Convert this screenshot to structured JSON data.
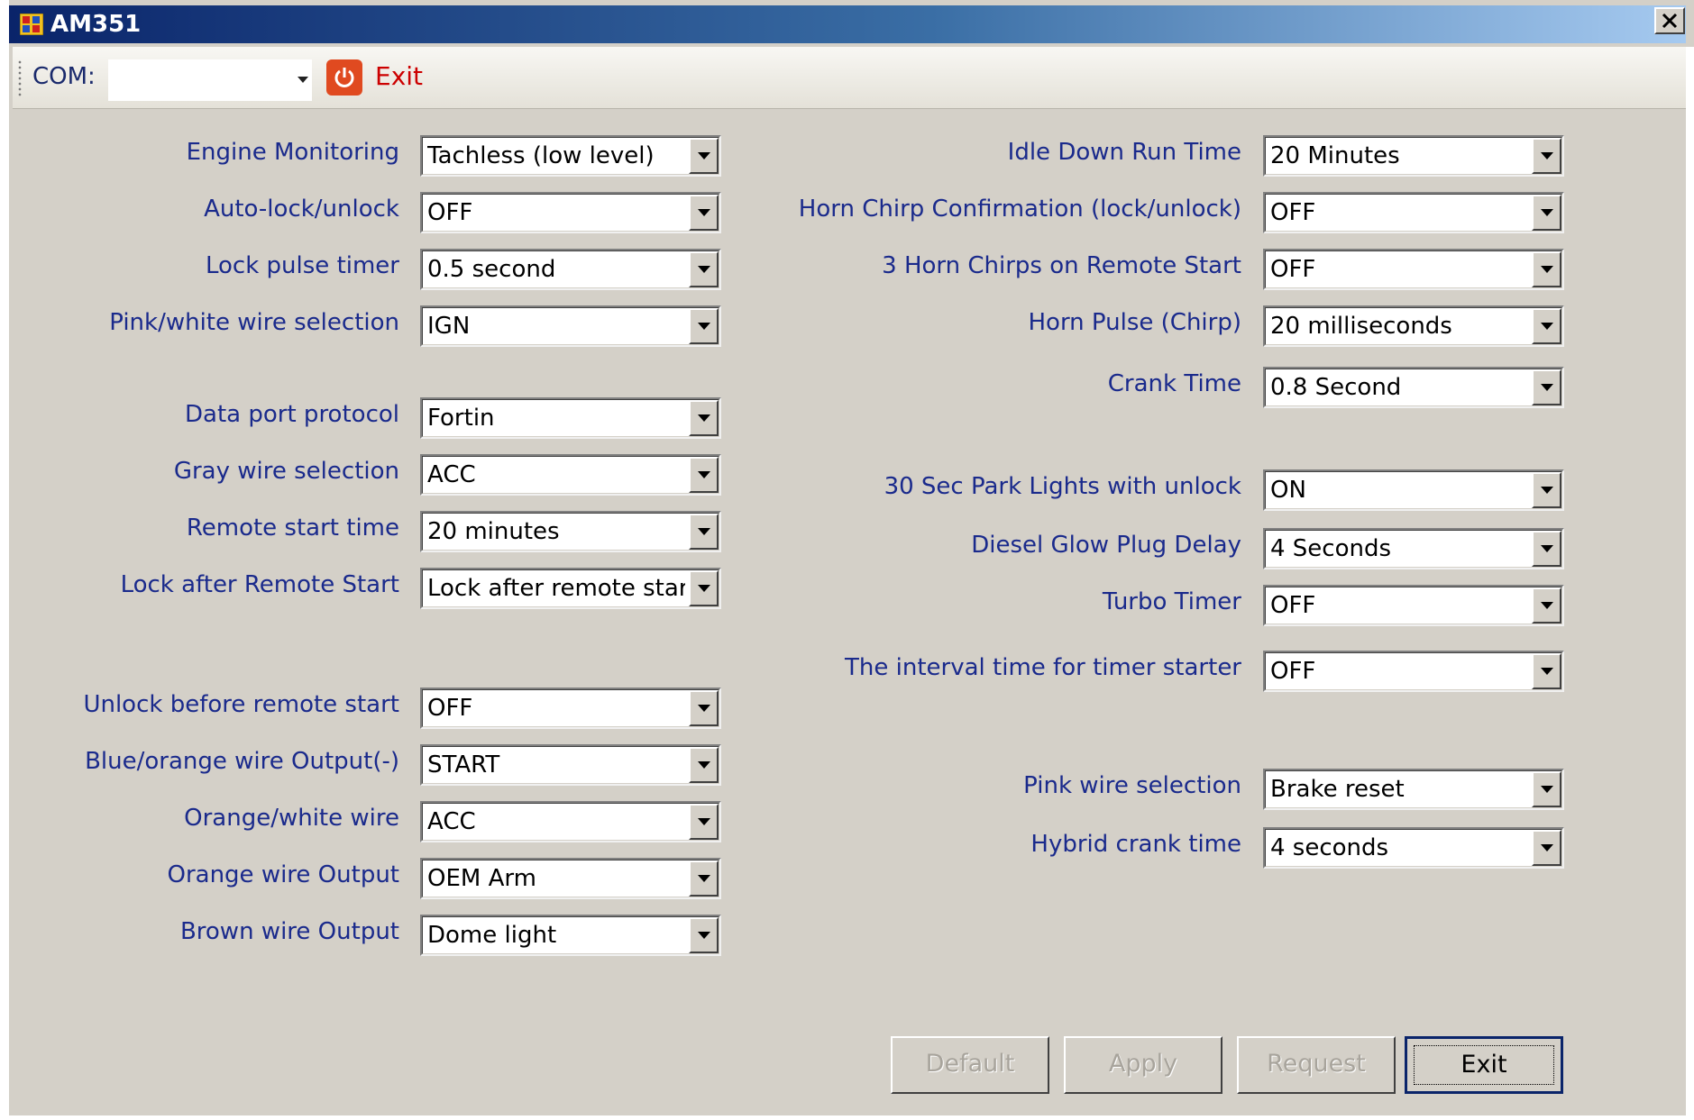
{
  "window": {
    "title": "AM351"
  },
  "toolbar": {
    "com_label": "COM:",
    "com_value": "",
    "exit_label": "Exit"
  },
  "left": [
    {
      "label": "Engine Monitoring",
      "value": "Tachless (low level)"
    },
    {
      "label": "Auto-lock/unlock",
      "value": "OFF"
    },
    {
      "label": "Lock pulse timer",
      "value": "0.5 second"
    },
    {
      "label": "Pink/white wire selection",
      "value": "IGN"
    },
    {
      "label": "Data port protocol",
      "value": "Fortin"
    },
    {
      "label": "Gray wire selection",
      "value": "ACC"
    },
    {
      "label": "Remote start time",
      "value": "20 minutes"
    },
    {
      "label": "Lock after Remote Start",
      "value": "Lock after remote start c"
    },
    {
      "label": "Unlock before remote start",
      "value": "OFF"
    },
    {
      "label": "Blue/orange wire Output(-)",
      "value": "START"
    },
    {
      "label": "Orange/white wire",
      "value": "ACC"
    },
    {
      "label": "Orange wire Output",
      "value": "OEM Arm"
    },
    {
      "label": "Brown wire Output",
      "value": "Dome light"
    }
  ],
  "right": [
    {
      "label": "Idle Down Run Time",
      "value": "20 Minutes"
    },
    {
      "label": "Horn Chirp Confirmation (lock/unlock)",
      "value": "OFF"
    },
    {
      "label": "3 Horn Chirps on Remote Start",
      "value": "OFF"
    },
    {
      "label": "Horn Pulse (Chirp)",
      "value": "20 milliseconds"
    },
    {
      "label": "Crank Time",
      "value": "0.8 Second"
    },
    {
      "label": "30 Sec Park Lights with unlock",
      "value": "ON"
    },
    {
      "label": "Diesel Glow Plug Delay",
      "value": "4 Seconds"
    },
    {
      "label": "Turbo Timer",
      "value": "OFF"
    },
    {
      "label": "The interval time for timer starter",
      "value": "OFF"
    },
    {
      "label": "Pink wire selection",
      "value": "Brake reset"
    },
    {
      "label": "Hybrid crank time",
      "value": "4 seconds"
    }
  ],
  "buttons": {
    "default": "Default",
    "apply": "Apply",
    "request": "Request",
    "exit": "Exit"
  }
}
